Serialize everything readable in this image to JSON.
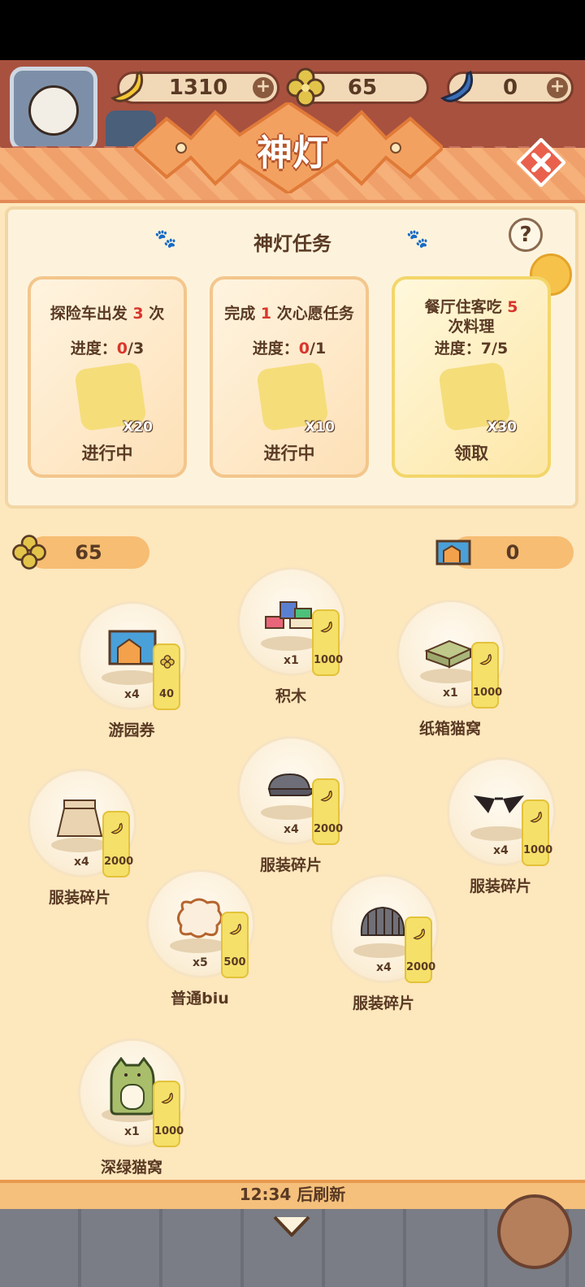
{
  "top": {
    "bananas": "1310",
    "clovers": "65",
    "blue_bananas": "0",
    "plus": "+"
  },
  "header": {
    "title": "神灯",
    "close": "✕"
  },
  "tasks_panel": {
    "title": "神灯任务",
    "help": "?"
  },
  "tasks": [
    {
      "pre": "探险车出发 ",
      "num": "3",
      "post": " 次",
      "prog_label": "进度：",
      "prog_cur": "0",
      "prog_total": "/3",
      "reward": "X20",
      "status": "进行中"
    },
    {
      "pre": "完成 ",
      "num": "1",
      "post": " 次心愿任务",
      "prog_label": "进度：",
      "prog_cur": "0",
      "prog_total": "/1",
      "reward": "X10",
      "status": "进行中"
    },
    {
      "pre": "餐厅住客吃 ",
      "num": "5",
      "post": "次料理",
      "prog_label": "进度：",
      "prog_cur": "7",
      "prog_total": "/5",
      "reward": "X30",
      "status": "领取"
    }
  ],
  "counters": {
    "clovers": "65",
    "tickets": "0"
  },
  "shop": [
    {
      "name": "游园券",
      "qty": "x4",
      "price": "40"
    },
    {
      "name": "积木",
      "qty": "x1",
      "price": "1000"
    },
    {
      "name": "纸箱猫窝",
      "qty": "x1",
      "price": "1000"
    },
    {
      "name": "服装碎片",
      "qty": "x4",
      "price": "2000"
    },
    {
      "name": "服装碎片",
      "qty": "x4",
      "price": "2000"
    },
    {
      "name": "服装碎片",
      "qty": "x4",
      "price": "1000"
    },
    {
      "name": "普通biu",
      "qty": "x5",
      "price": "500"
    },
    {
      "name": "服装碎片",
      "qty": "x4",
      "price": "2000"
    },
    {
      "name": "深绿猫窝",
      "qty": "x1",
      "price": "1000"
    }
  ],
  "footer": {
    "refresh": "12:34 后刷新"
  },
  "colors": {
    "accent": "#f0a06a",
    "card_border": "#f3c68c",
    "price_tag": "#f5e06a",
    "highlight": "#d8362c"
  }
}
